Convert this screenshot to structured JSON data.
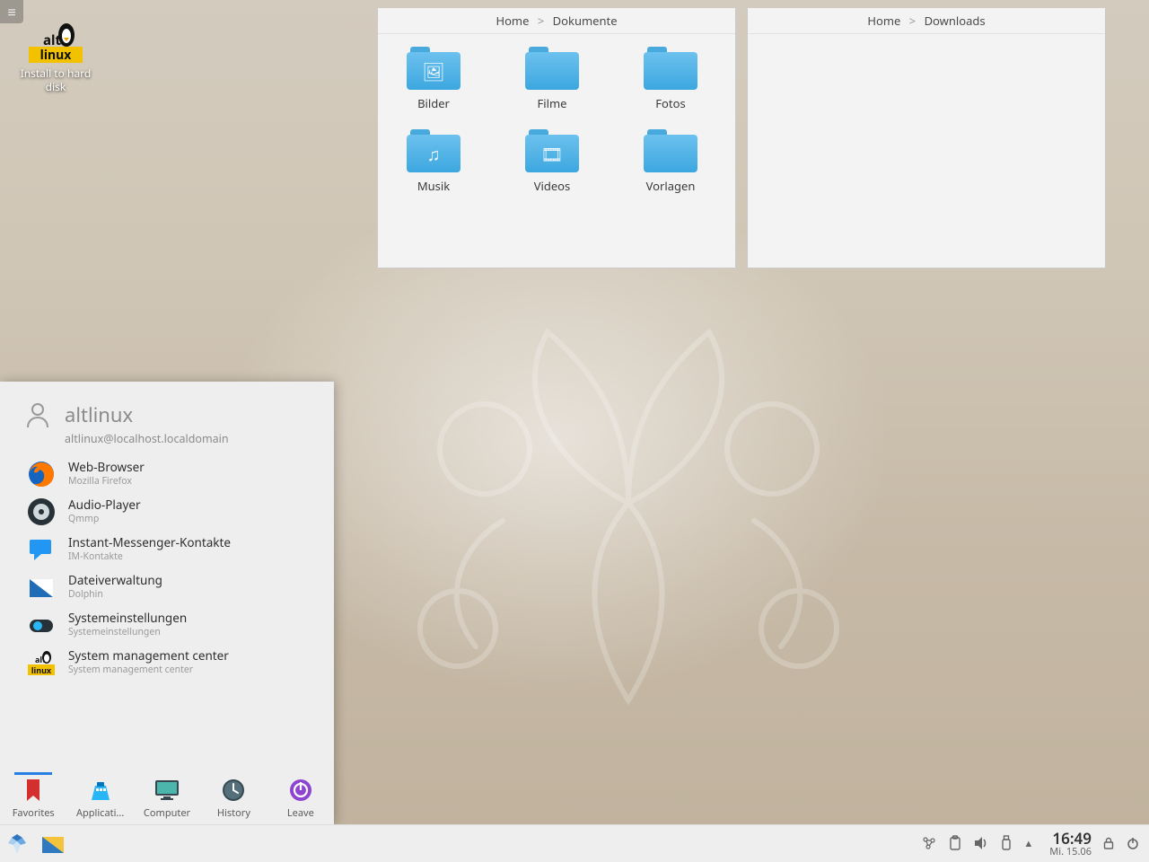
{
  "desktop": {
    "install_label": "Install to hard disk"
  },
  "folderviews": {
    "a": {
      "crumb_root": "Home",
      "crumb_leaf": "Dokumente",
      "items": [
        {
          "label": "Bilder",
          "glyph": "🖼"
        },
        {
          "label": "Filme",
          "glyph": ""
        },
        {
          "label": "Fotos",
          "glyph": ""
        },
        {
          "label": "Musik",
          "glyph": "♫"
        },
        {
          "label": "Videos",
          "glyph": "🎞"
        },
        {
          "label": "Vorlagen",
          "glyph": ""
        }
      ]
    },
    "b": {
      "crumb_root": "Home",
      "crumb_leaf": "Downloads"
    }
  },
  "kickoff": {
    "user": "altlinux",
    "host": "altlinux@localhost.localdomain",
    "favorites": [
      {
        "title": "Web-Browser",
        "subtitle": "Mozilla Firefox",
        "icon": "firefox"
      },
      {
        "title": "Audio-Player",
        "subtitle": "Qmmp",
        "icon": "qmmp"
      },
      {
        "title": "Instant-Messenger-Kontakte",
        "subtitle": "IM-Kontakte",
        "icon": "chat"
      },
      {
        "title": "Dateiverwaltung",
        "subtitle": "Dolphin",
        "icon": "dolphin"
      },
      {
        "title": "Systemeinstellungen",
        "subtitle": "Systemeinstellungen",
        "icon": "settings"
      },
      {
        "title": "System management center",
        "subtitle": "System management center",
        "icon": "altcenter"
      }
    ],
    "tabs": [
      {
        "label": "Favorites",
        "icon": "bookmark",
        "active": true
      },
      {
        "label": "Applicati...",
        "icon": "apps",
        "active": false
      },
      {
        "label": "Computer",
        "icon": "monitor",
        "active": false
      },
      {
        "label": "History",
        "icon": "history",
        "active": false
      },
      {
        "label": "Leave",
        "icon": "leave",
        "active": false
      }
    ]
  },
  "panel": {
    "clock_time": "16:49",
    "clock_date": "Mi. 15.06"
  }
}
